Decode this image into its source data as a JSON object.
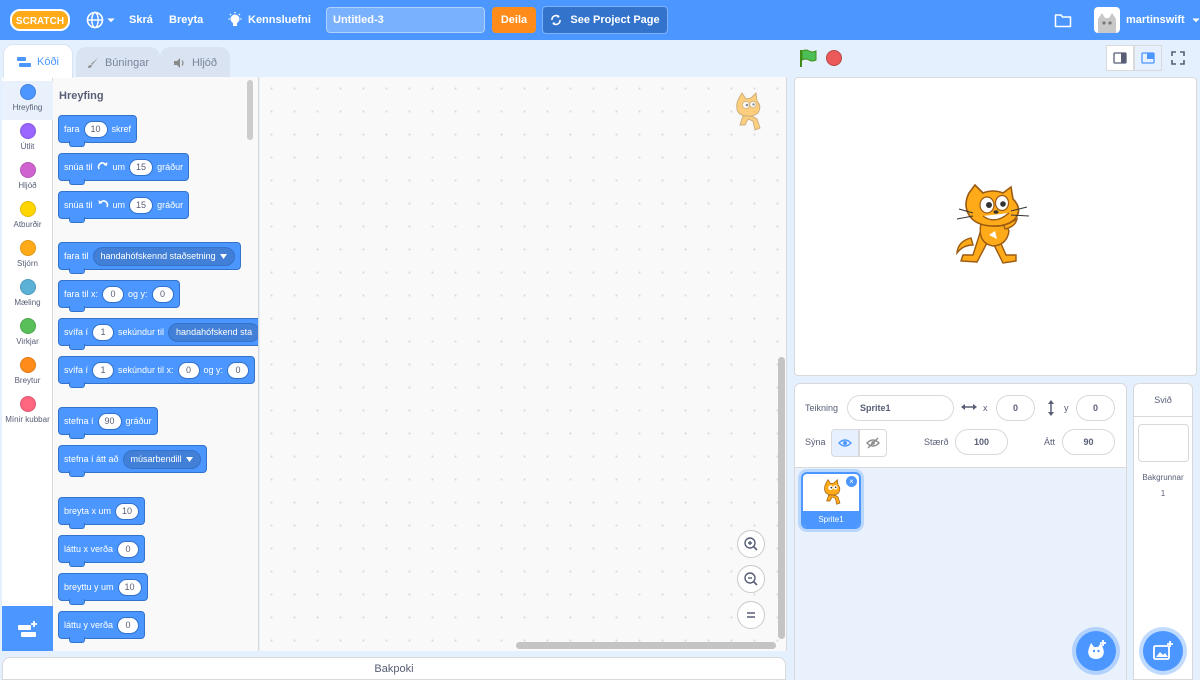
{
  "menu": {
    "logo_text": "SCRATCH",
    "file": "Skrá",
    "edit": "Breyta",
    "tutorials": "Kennsluefni",
    "project_title": "Untitled-3",
    "share": "Deila",
    "see_project_page": "See Project Page",
    "username": "martinswift"
  },
  "tabs": {
    "code": "Kóði",
    "costumes": "Búningar",
    "sounds": "Hljóð"
  },
  "categories": [
    {
      "label": "Hreyfing",
      "color": "#4c97ff"
    },
    {
      "label": "Útlit",
      "color": "#9966ff"
    },
    {
      "label": "Hljóð",
      "color": "#cf63cf"
    },
    {
      "label": "Atburðir",
      "color": "#ffd500"
    },
    {
      "label": "Stjórn",
      "color": "#ffab19"
    },
    {
      "label": "Mæling",
      "color": "#5cb1d6"
    },
    {
      "label": "Virkjar",
      "color": "#59c059"
    },
    {
      "label": "Breytur",
      "color": "#ff8c1a"
    },
    {
      "label": "Mínir kubbar",
      "color": "#ff6680"
    }
  ],
  "flyout": {
    "heading": "Hreyfing",
    "move": {
      "t1": "fara",
      "v1": "10",
      "t2": "skref"
    },
    "turn_right": {
      "t1": "snúa til",
      "t2": "um",
      "v1": "15",
      "t3": "gráður"
    },
    "turn_left": {
      "t1": "snúa til",
      "t2": "um",
      "v1": "15",
      "t3": "gráður"
    },
    "goto": {
      "t1": "fara til",
      "d1": "handahófskennd staðsetning"
    },
    "goto_xy": {
      "t1": "fara til x:",
      "v1": "0",
      "t2": "og y:",
      "v2": "0"
    },
    "glide_to": {
      "t1": "svífa í",
      "v1": "1",
      "t2": "sekúndur til",
      "d1": "handahófskend sta"
    },
    "glide_xy": {
      "t1": "svífa í",
      "v1": "1",
      "t2": "sekúndur til x:",
      "v2": "0",
      "t3": "og y:",
      "v3": "0"
    },
    "point_dir": {
      "t1": "stefna í",
      "v1": "90",
      "t2": "gráður"
    },
    "point_towards": {
      "t1": "stefna í átt að",
      "d1": "músarbendill"
    },
    "change_x": {
      "t1": "breyta x um",
      "v1": "10"
    },
    "set_x": {
      "t1": "láttu x verða",
      "v1": "0"
    },
    "change_y": {
      "t1": "breyttu y um",
      "v1": "10"
    },
    "set_y": {
      "t1": "láttu y verða",
      "v1": "0"
    }
  },
  "backpack": "Bakpoki",
  "sprite_info": {
    "sprite_label": "Teikning",
    "sprite_name": "Sprite1",
    "x_label": "x",
    "x_value": "0",
    "y_label": "y",
    "y_value": "0",
    "show_label": "Sýna",
    "size_label": "Stærð",
    "size_value": "100",
    "direction_label": "Átt",
    "direction_value": "90"
  },
  "sprites": [
    {
      "name": "Sprite1"
    }
  ],
  "stage_panel": {
    "title": "Svið",
    "backdrops_label": "Bakgrunnar",
    "backdrops_count": "1"
  }
}
